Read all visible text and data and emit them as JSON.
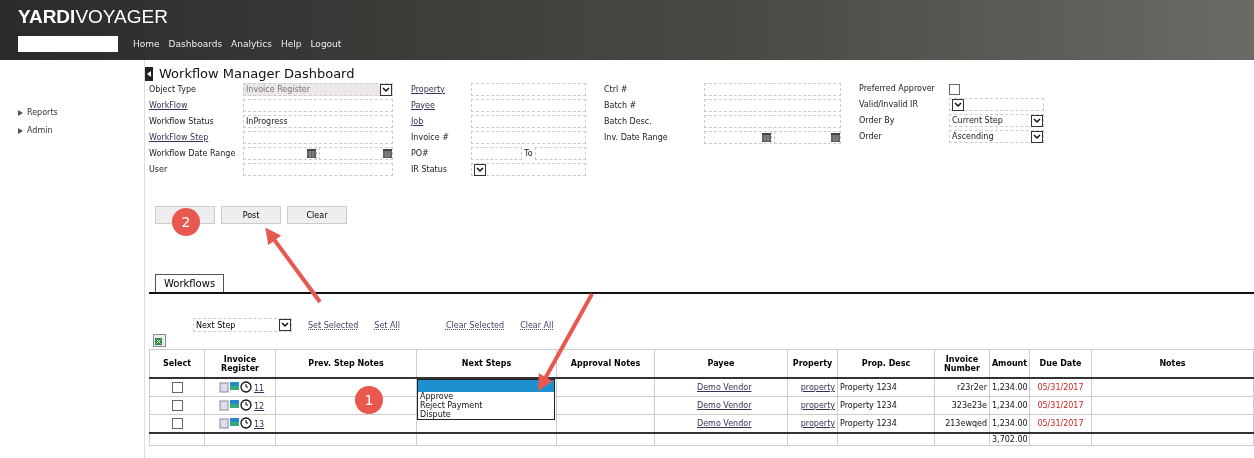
{
  "header": {
    "logo_bold": "YARDI",
    "logo_light": "VOYAGER",
    "nav": [
      "Home",
      "Dashboards",
      "Analytics",
      "Help",
      "Logout"
    ]
  },
  "sidebar": {
    "items": [
      "Reports",
      "Admin"
    ]
  },
  "title": "Workflow Manager Dashboard",
  "form": [
    [
      {
        "label": "Object Type",
        "link": false,
        "kind": "select",
        "value": "Invoice Register",
        "disabled": true
      },
      {
        "label": "WorkFlow",
        "link": true,
        "kind": "text"
      },
      {
        "label": "Workflow Status",
        "link": false,
        "kind": "text",
        "value": "InProgress"
      },
      {
        "label": "WorkFlow Step",
        "link": true,
        "kind": "text"
      },
      {
        "label": "Workflow Date Range",
        "link": false,
        "kind": "date"
      },
      {
        "label": "User",
        "link": false,
        "kind": "text"
      }
    ],
    [
      {
        "label": "Property",
        "link": true,
        "kind": "text"
      },
      {
        "label": "Payee",
        "link": true,
        "kind": "text"
      },
      {
        "label": "Job",
        "link": true,
        "kind": "text"
      },
      {
        "label": "Invoice #",
        "link": false,
        "kind": "text"
      },
      {
        "label": "PO#",
        "link": false,
        "kind": "range",
        "to": "To"
      },
      {
        "label": "IR Status",
        "link": false,
        "kind": "select"
      }
    ],
    [
      {
        "label": "Ctrl #",
        "link": false,
        "kind": "text"
      },
      {
        "label": "Batch #",
        "link": false,
        "kind": "text"
      },
      {
        "label": "Batch Desc.",
        "link": false,
        "kind": "text"
      },
      {
        "label": "Inv. Date Range",
        "link": false,
        "kind": "date"
      }
    ],
    [
      {
        "label": "Preferred Approver",
        "link": false,
        "kind": "checkbox",
        "checked": false
      },
      {
        "label": "Valid/Invalid IR",
        "link": false,
        "kind": "select"
      },
      {
        "label": "Order By",
        "link": false,
        "kind": "select",
        "value": "Current Step"
      },
      {
        "label": "Order",
        "link": false,
        "kind": "select",
        "value": "Ascending"
      }
    ]
  ],
  "buttons": [
    {
      "kind": "covered"
    },
    {
      "kind": "text",
      "label": "Post"
    },
    {
      "kind": "text",
      "label": "Clear"
    }
  ],
  "tabs": [
    {
      "label": "Workflows",
      "selected": true
    }
  ],
  "toolbar": {
    "select": "Next Step",
    "links": [
      "Set Selected",
      "Set All",
      "Clear Selected",
      "Clear All"
    ]
  },
  "table": {
    "columns": [
      "Select",
      "Invoice Register",
      "Prev. Step Notes",
      "Next Steps",
      "Approval Notes",
      "Payee",
      "Property",
      "Prop. Desc",
      "Invoice Number",
      "Amount",
      "Due Date",
      "Notes"
    ],
    "rows": [
      {
        "checked": false,
        "register": "11",
        "payee": "Demo Vendor",
        "property": "property",
        "desc": "Property 1234",
        "invoice": "r23r2er",
        "amount": "1,234.00",
        "due": "05/31/2017"
      },
      {
        "checked": false,
        "register": "12",
        "payee": "Demo Vendor",
        "property": "property",
        "desc": "Property 1234",
        "invoice": "323e23e",
        "amount": "1,234.00",
        "due": "05/31/2017"
      },
      {
        "checked": false,
        "register": "13",
        "payee": "Demo Vendor",
        "property": "property",
        "desc": "Property 1234",
        "invoice": "213ewqed",
        "amount": "1,234.00",
        "due": "05/31/2017"
      }
    ],
    "total": "3,702.00"
  },
  "dropdown": {
    "options": [
      {
        "kind": "blank",
        "selected": true
      },
      {
        "kind": "option",
        "label": "Approve",
        "selected": false
      },
      {
        "kind": "option",
        "label": "Reject Payment",
        "selected": false
      },
      {
        "kind": "option",
        "label": "Dispute",
        "selected": false
      }
    ]
  },
  "callouts": [
    "1",
    "2"
  ]
}
